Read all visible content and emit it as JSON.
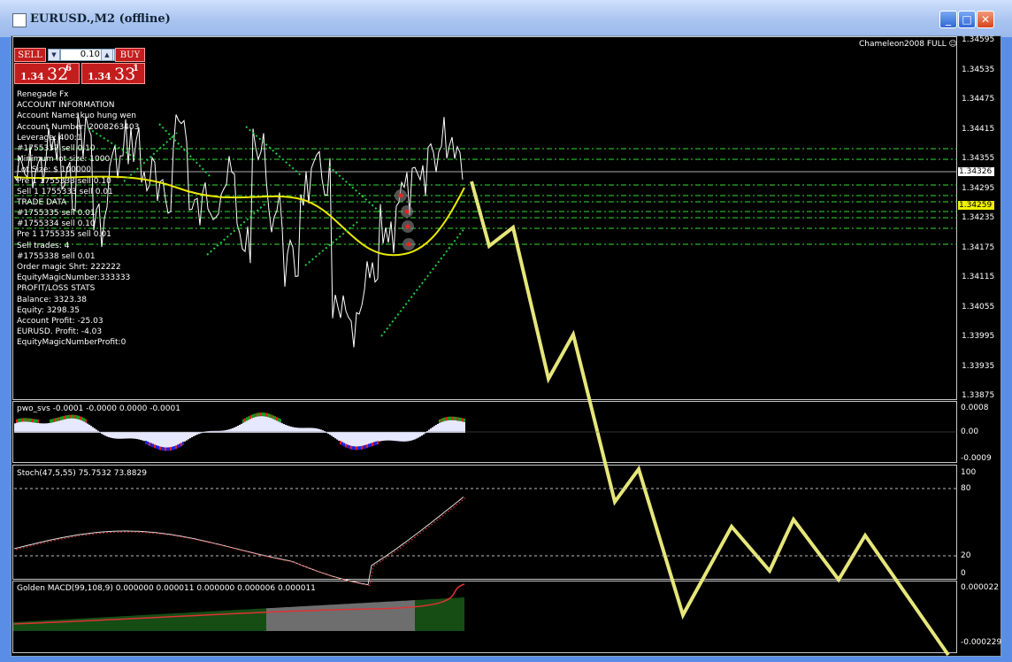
{
  "window": {
    "title": "EURUSD.,M2 (offline)",
    "minimize": "_",
    "maximize": "□",
    "close": "✕",
    "icon": "chart-window-icon"
  },
  "trade_panel": {
    "sell_label": "SELL",
    "buy_label": "BUY",
    "lot_value": "0.10",
    "sell_price": {
      "prefix": "1.34",
      "big": "32",
      "sup": "6"
    },
    "buy_price": {
      "prefix": "1.34",
      "big": "33",
      "sup": "1"
    }
  },
  "ea_label": "Chameleon2008 FULL ☺",
  "info_lines": [
    "Renegade Fx",
    "ACCOUNT INFORMATION",
    "Account Name: kuo hung wen",
    "Account Number: 2008263403",
    "Leverage: 400:1",
    "#1755337 sell 0.10",
    "Minimum lot size: 1000",
    "Lot Size: $ 100000",
    "Pre 1 1755333 sell 0.10",
    "Sell 1 1755333 sell 0.01",
    "TRADE DATA",
    "#1755335 sell 0.01",
    "#1755334 sell 0.10",
    "Pre 1 1755335 sell 0.01",
    "Sell trades: 4",
    "#1755338 sell 0.01",
    "Order magic Shrt: 222222",
    "EquityMagicNumber:333333",
    "PROFIT/LOSS STATS",
    "Balance: 3323.38",
    "Equity: 3298.35",
    "Account Profit: -25.03",
    "EURUSD. Profit: -4.03",
    "EquityMagicNumberProfit:0"
  ],
  "price_axis": [
    "1.34595",
    "1.34535",
    "1.34475",
    "1.34415",
    "1.34355",
    "1.34295",
    "1.34235",
    "1.34175",
    "1.34115",
    "1.34055",
    "1.33995",
    "1.33935",
    "1.33875"
  ],
  "current_price_tags": {
    "bid": "1.34326",
    "level": "1.34259"
  },
  "indicators": {
    "pwo": {
      "label": "pwo_svs -0.0001 -0.0000 0.0000 -0.0001",
      "axis": [
        "0.0008",
        "0.00",
        "-0.0009"
      ]
    },
    "stoch": {
      "label": "Stoch(47,5,55) 75.7532 73.8829",
      "axis": [
        "100",
        "80",
        "20",
        "0"
      ]
    },
    "macd": {
      "label": "Golden MACD(99,108,9) 0.000000 0.000011 0.000000 0.000006 0.000011",
      "axis": [
        "0.000022",
        "-0.000229"
      ]
    }
  },
  "colors": {
    "price_line": "#ffffff",
    "ma": "#e8e800",
    "zigzag": "#e6e67a",
    "trend": "#22cc44",
    "green_levels": "#33dd33"
  }
}
